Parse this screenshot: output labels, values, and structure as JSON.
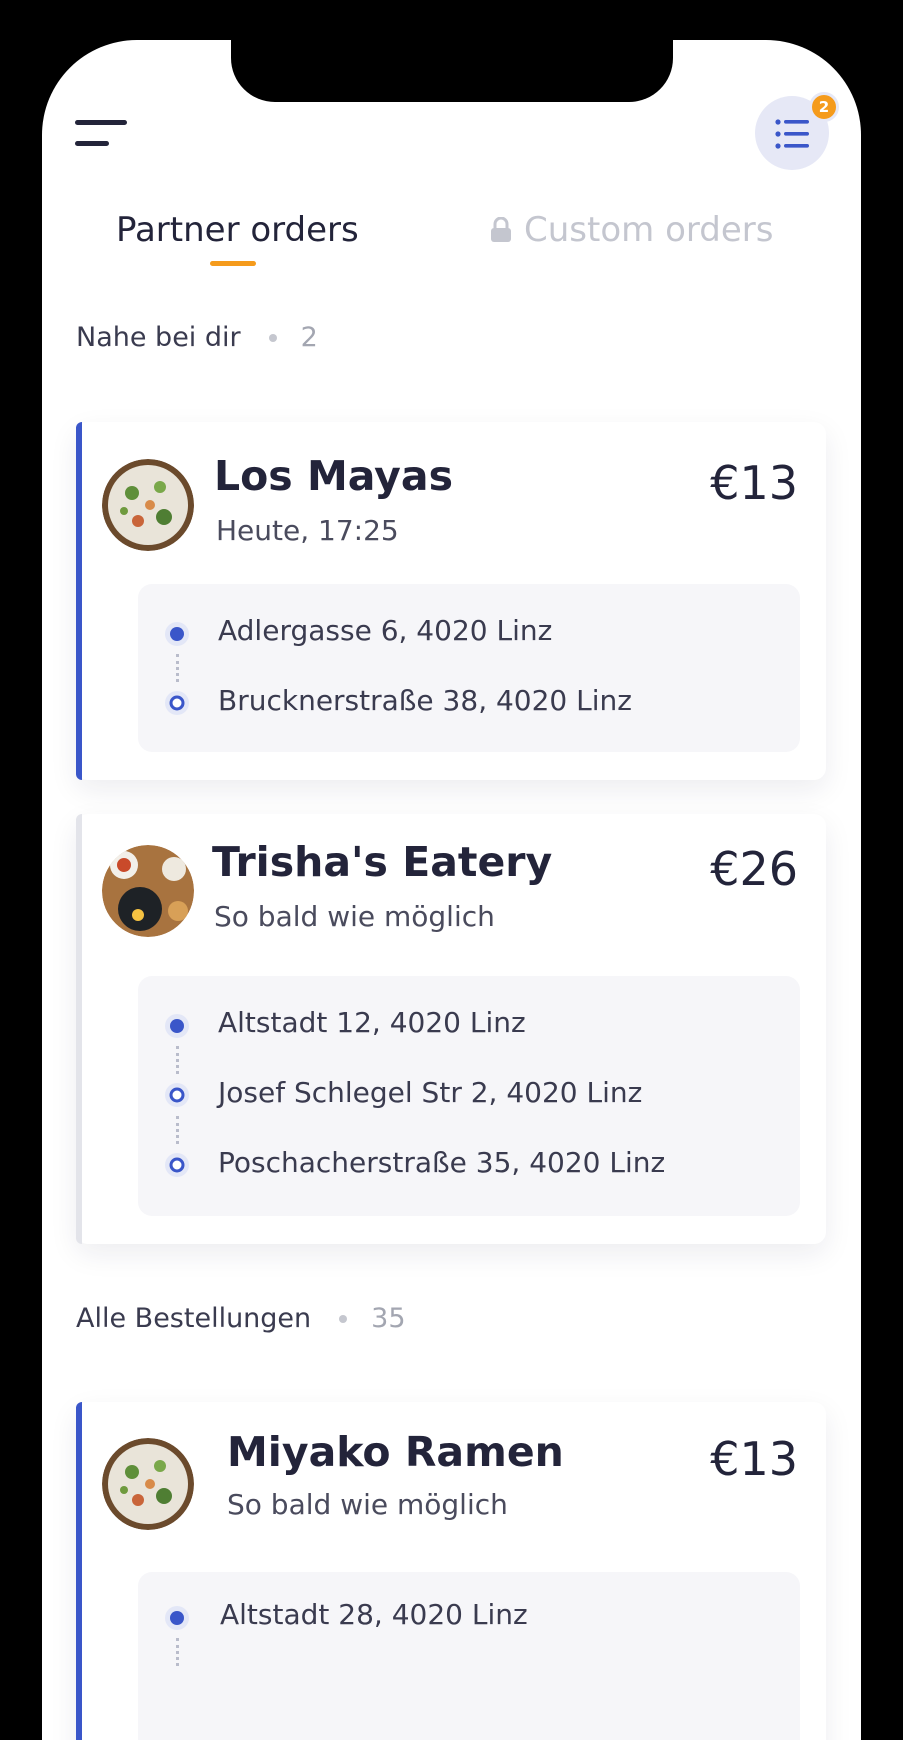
{
  "header": {
    "notification_count": "2"
  },
  "tabs": [
    {
      "label": "Partner orders",
      "active": true
    },
    {
      "label": "Custom orders",
      "locked": true
    }
  ],
  "sections": {
    "nearby": {
      "title": "Nahe bei dir",
      "count": "2"
    },
    "all": {
      "title": "Alle Bestellungen",
      "count": "35"
    }
  },
  "orders": [
    {
      "restaurant": "Los Mayas",
      "time": "Heute, 17:25",
      "price": "€13",
      "stops": [
        "Adlergasse 6, 4020 Linz",
        "Brucknerstraße 38, 4020 Linz"
      ]
    },
    {
      "restaurant": "Trisha's Eatery",
      "time": "So bald wie möglich",
      "price": "€26",
      "stops": [
        "Altstadt 12, 4020 Linz",
        "Josef Schlegel Str 2, 4020 Linz",
        "Poschacherstraße 35, 4020 Linz"
      ]
    },
    {
      "restaurant": "Miyako Ramen",
      "time": "So bald wie möglich",
      "price": "€13",
      "stops": [
        "Altstadt 28, 4020 Linz"
      ]
    }
  ],
  "colors": {
    "accent_blue": "#3a56c9",
    "accent_orange": "#f59b1c",
    "text_dark": "#23243a"
  },
  "icons": [
    "hamburger-menu-icon",
    "list-icon",
    "lock-icon",
    "pickup-dot-icon",
    "dropoff-ring-icon"
  ]
}
